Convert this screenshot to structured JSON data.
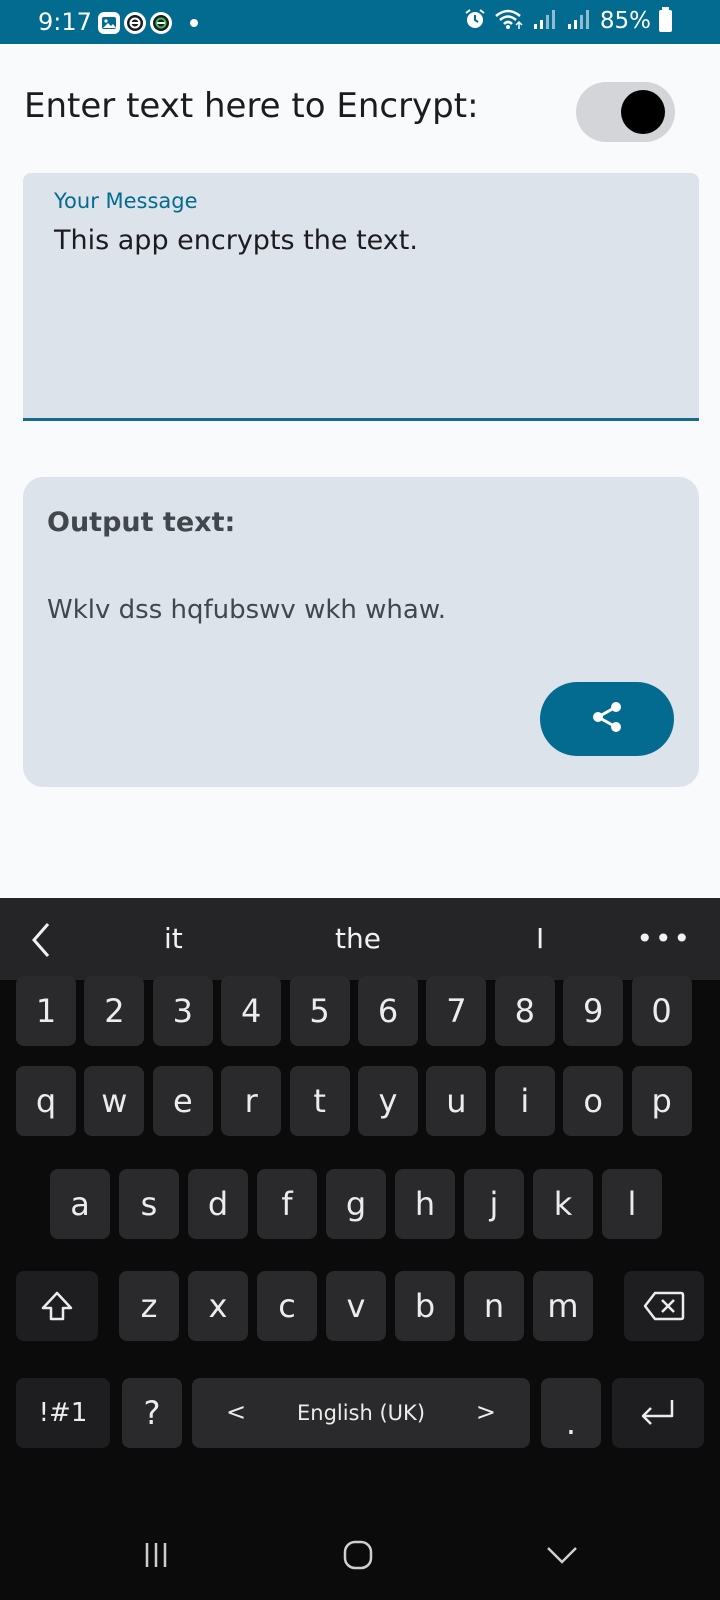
{
  "status_bar": {
    "time": "9:17",
    "battery": "85%",
    "icons": [
      "gallery-icon",
      "app-notification-icon",
      "app-notification-icon",
      "alarm-icon",
      "wifi-icon",
      "signal-icon",
      "signal-icon",
      "battery-icon"
    ]
  },
  "header": {
    "label": "Enter text here to  Encrypt:",
    "encrypt_toggle_on": true
  },
  "input": {
    "label": "Your Message",
    "value": "This app encrypts the text."
  },
  "output": {
    "title": "Output text:",
    "value": "Wklv dss hqfubswv wkh whaw.",
    "share_icon": "share-icon"
  },
  "keyboard": {
    "suggestions": [
      "it",
      "the",
      "I"
    ],
    "more": "•••",
    "row_numbers": [
      "1",
      "2",
      "3",
      "4",
      "5",
      "6",
      "7",
      "8",
      "9",
      "0"
    ],
    "row1": [
      "q",
      "w",
      "e",
      "r",
      "t",
      "y",
      "u",
      "i",
      "o",
      "p"
    ],
    "row2": [
      "a",
      "s",
      "d",
      "f",
      "g",
      "h",
      "j",
      "k",
      "l"
    ],
    "row3": [
      "z",
      "x",
      "c",
      "v",
      "b",
      "n",
      "m"
    ],
    "symbols_key": "!#1",
    "question_key": "?",
    "space_label": "English (UK)",
    "space_left": "<",
    "space_right": ">",
    "period_key": "."
  },
  "colors": {
    "primary": "#046b90",
    "surface": "#dde3ea",
    "background": "#f9fafc",
    "keyboard_bg": "#0b0b0c",
    "key_bg": "#2a2a2c"
  }
}
